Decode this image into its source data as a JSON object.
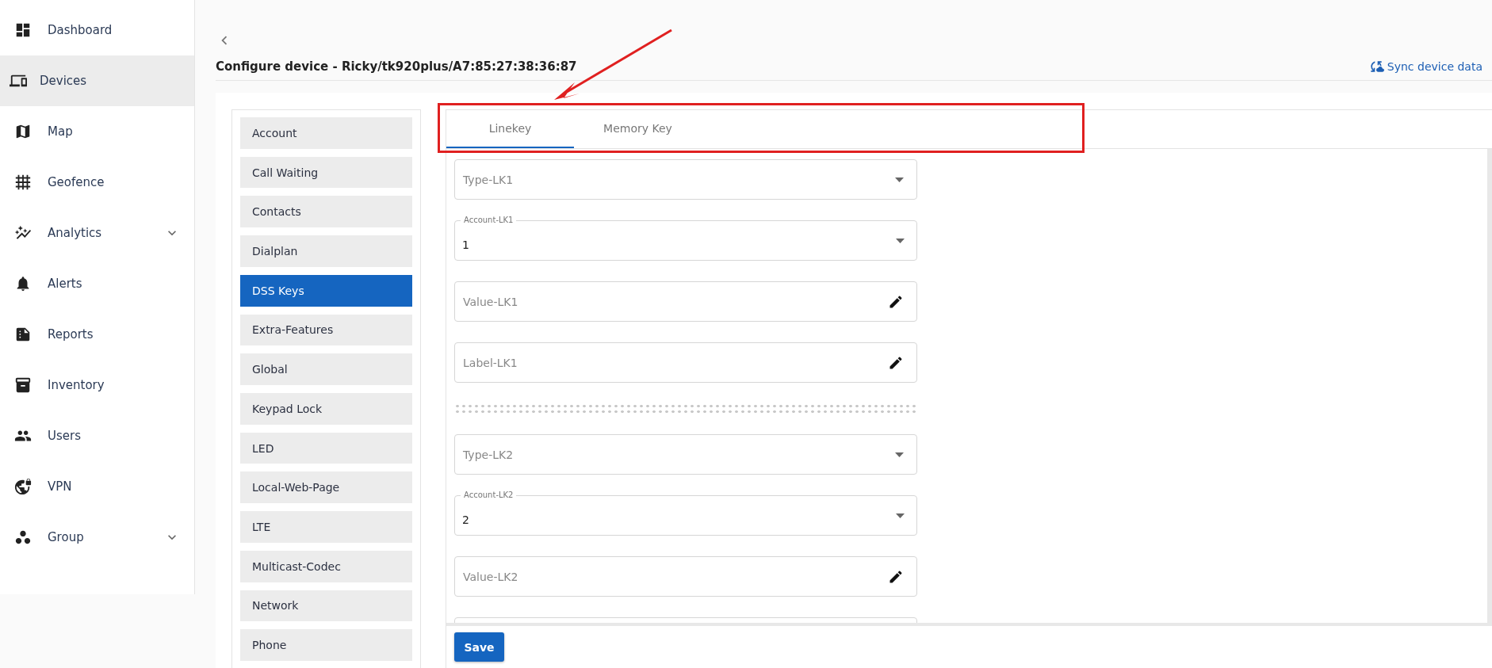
{
  "nav": {
    "items": [
      {
        "label": "Dashboard",
        "kind": "link",
        "selected": false
      },
      {
        "label": "Devices",
        "kind": "link",
        "selected": true
      },
      {
        "label": "Map",
        "kind": "link",
        "selected": false
      },
      {
        "label": "Geofence",
        "kind": "link",
        "selected": false
      },
      {
        "label": "Analytics",
        "kind": "group",
        "selected": false,
        "expanded": false
      },
      {
        "label": "Alerts",
        "kind": "link",
        "selected": false
      },
      {
        "label": "Reports",
        "kind": "link",
        "selected": false
      },
      {
        "label": "Inventory",
        "kind": "link",
        "selected": false
      },
      {
        "label": "Users",
        "kind": "link",
        "selected": false
      },
      {
        "label": "VPN",
        "kind": "link",
        "selected": false
      },
      {
        "label": "Group",
        "kind": "group",
        "selected": false,
        "expanded": false
      }
    ]
  },
  "page": {
    "title": "Configure device - Ricky/tk920plus/A7:85:27:38:36:87",
    "sync_action": "Sync device data"
  },
  "sections": [
    {
      "label": "Account",
      "selected": false
    },
    {
      "label": "Call Waiting",
      "selected": false
    },
    {
      "label": "Contacts",
      "selected": false
    },
    {
      "label": "Dialplan",
      "selected": false
    },
    {
      "label": "DSS Keys",
      "selected": true
    },
    {
      "label": "Extra-Features",
      "selected": false
    },
    {
      "label": "Global",
      "selected": false
    },
    {
      "label": "Keypad Lock",
      "selected": false
    },
    {
      "label": "LED",
      "selected": false
    },
    {
      "label": "Local-Web-Page",
      "selected": false
    },
    {
      "label": "LTE",
      "selected": false
    },
    {
      "label": "Multicast-Codec",
      "selected": false
    },
    {
      "label": "Network",
      "selected": false
    },
    {
      "label": "Phone",
      "selected": false
    }
  ],
  "tabs": [
    {
      "label": "Linekey",
      "selected": true
    },
    {
      "label": "Memory Key",
      "selected": false
    }
  ],
  "fields": [
    {
      "kind": "select",
      "label": "Type-LK1"
    },
    {
      "kind": "select",
      "label": "Account-LK1",
      "value": "1"
    },
    {
      "kind": "text",
      "label": "Value-LK1"
    },
    {
      "kind": "text",
      "label": "Label-LK1"
    },
    {
      "kind": "divider"
    },
    {
      "kind": "select",
      "label": "Type-LK2"
    },
    {
      "kind": "select",
      "label": "Account-LK2",
      "value": "2"
    },
    {
      "kind": "text",
      "label": "Value-LK2"
    },
    {
      "kind": "text"
    }
  ],
  "save_button": "Save"
}
